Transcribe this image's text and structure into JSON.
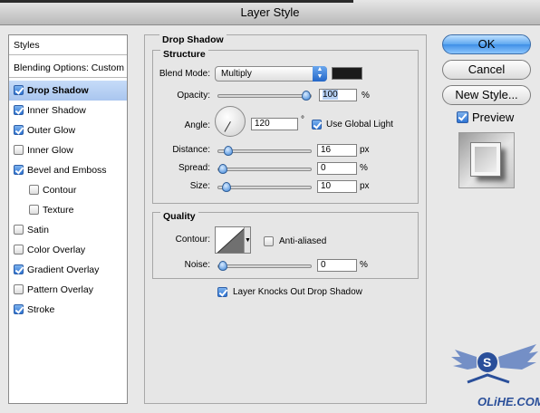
{
  "window": {
    "title": "Layer Style"
  },
  "styles_list": {
    "header": "Styles",
    "blending": "Blending Options: Custom",
    "items": [
      {
        "label": "Drop Shadow",
        "checked": true,
        "selected": true,
        "indent": false
      },
      {
        "label": "Inner Shadow",
        "checked": true,
        "selected": false,
        "indent": false
      },
      {
        "label": "Outer Glow",
        "checked": true,
        "selected": false,
        "indent": false
      },
      {
        "label": "Inner Glow",
        "checked": false,
        "selected": false,
        "indent": false
      },
      {
        "label": "Bevel and Emboss",
        "checked": true,
        "selected": false,
        "indent": false
      },
      {
        "label": "Contour",
        "checked": false,
        "selected": false,
        "indent": true
      },
      {
        "label": "Texture",
        "checked": false,
        "selected": false,
        "indent": true
      },
      {
        "label": "Satin",
        "checked": false,
        "selected": false,
        "indent": false
      },
      {
        "label": "Color Overlay",
        "checked": false,
        "selected": false,
        "indent": false
      },
      {
        "label": "Gradient Overlay",
        "checked": true,
        "selected": false,
        "indent": false
      },
      {
        "label": "Pattern Overlay",
        "checked": false,
        "selected": false,
        "indent": false
      },
      {
        "label": "Stroke",
        "checked": true,
        "selected": false,
        "indent": false
      }
    ]
  },
  "drop_shadow": {
    "title": "Drop Shadow",
    "structure": {
      "title": "Structure",
      "blend_mode_label": "Blend Mode:",
      "blend_mode_value": "Multiply",
      "shadow_color": "#1b1b1b",
      "opacity_label": "Opacity:",
      "opacity_value": "100",
      "opacity_level": 1.0,
      "angle_label": "Angle:",
      "angle_value": "120",
      "angle_unit": "°",
      "use_global_light_label": "Use Global Light",
      "use_global_light": true,
      "distance_label": "Distance:",
      "distance_value": "16",
      "distance_level": 0.07,
      "spread_label": "Spread:",
      "spread_value": "0",
      "spread_level": 0.0,
      "size_label": "Size:",
      "size_value": "10",
      "size_level": 0.04,
      "unit_percent": "%",
      "unit_px": "px"
    },
    "quality": {
      "title": "Quality",
      "contour_label": "Contour:",
      "anti_aliased_label": "Anti-aliased",
      "anti_aliased": false,
      "noise_label": "Noise:",
      "noise_value": "0",
      "noise_level": 0.0,
      "unit_percent": "%"
    },
    "knockout_label": "Layer Knocks Out Drop Shadow",
    "knockout": true
  },
  "buttons": {
    "ok": "OK",
    "cancel": "Cancel",
    "new_style": "New Style...",
    "preview_label": "Preview",
    "preview": true
  },
  "watermark": {
    "text": "OLiHE.COM"
  },
  "colors": {
    "accent": "#3f8fe6",
    "selection": "#b6d0f4"
  }
}
